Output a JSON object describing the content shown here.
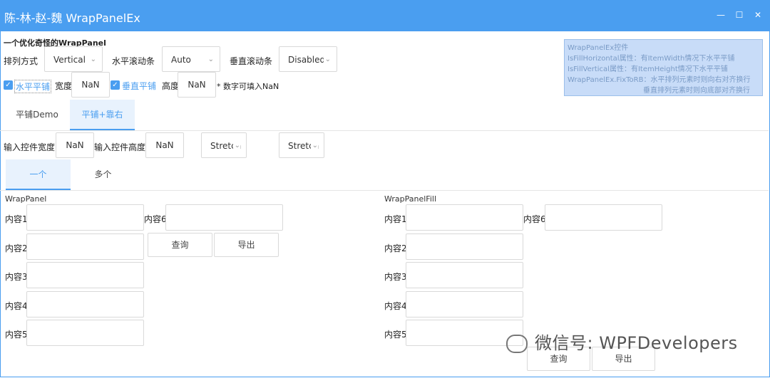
{
  "window": {
    "title": "陈-林-赵-魏 WrapPanelEx",
    "minimize": "—",
    "maximize": "☐",
    "close": "✕"
  },
  "heading": "一个优化奇怪的WrapPanel",
  "row1": {
    "orient_label": "排列方式",
    "orient_value": "Vertical",
    "hscroll_label": "水平滚动条",
    "hscroll_value": "Auto",
    "vscroll_label": "垂直滚动条",
    "vscroll_value": "Disabled"
  },
  "row2": {
    "fill_h_label": "水平平铺",
    "width_label": "宽度",
    "width_value": "NaN",
    "fill_v_label": "垂直平铺",
    "height_label": "高度",
    "height_value": "NaN",
    "note": "* 数字可填入NaN"
  },
  "info": {
    "lines": [
      "WrapPanelEx控件",
      "IsFillHorizontal属性：有ItemWidth情况下水平平铺",
      "IsFillVertical属性：有ItemHeight情况下水平平铺",
      "WrapPanelEx.FixToRB：水平排列元素时则向右对齐换行",
      "垂直排列元素时则向底部对齐换行"
    ]
  },
  "tabs1": [
    "平铺Demo",
    "平铺+靠右"
  ],
  "row3": {
    "ctrl_width_label": "输入控件宽度",
    "ctrl_width_value": "NaN",
    "ctrl_height_label": "输入控件高度",
    "ctrl_height_value": "NaN",
    "halign_value": "Stretch",
    "valign_value": "Stretch"
  },
  "tabs2": [
    "一个",
    "多个"
  ],
  "left_panel": {
    "title": "WrapPanel",
    "labels": [
      "内容1",
      "内容2",
      "内容3",
      "内容4",
      "内容5",
      "内容6"
    ],
    "query": "查询",
    "export": "导出"
  },
  "right_panel": {
    "title": "WrapPanelFill",
    "labels": [
      "内容1",
      "内容2",
      "内容3",
      "内容4",
      "内容5",
      "内容6"
    ],
    "query": "查询",
    "export": "导出"
  },
  "watermark": "微信号: WPFDevelopers",
  "colors": {
    "accent": "#4a9ef0",
    "note": "#ee3333",
    "info_bg": "#c8dcf8"
  }
}
